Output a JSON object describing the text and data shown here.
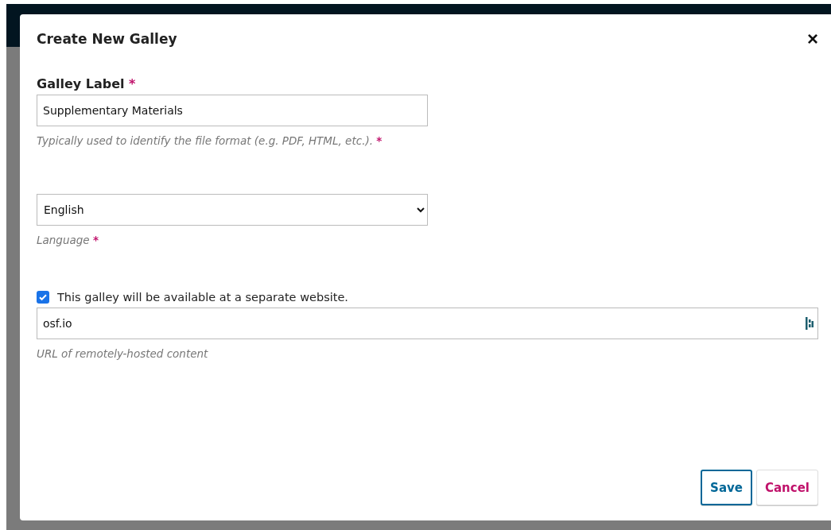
{
  "dialog": {
    "title": "Create New Galley",
    "close": "×"
  },
  "fields": [
    {
      "kind": "text",
      "label": "Galley Label",
      "label_mark": "*",
      "value": "Supplementary Materials",
      "hint": "Typically used to identify the file format (e.g. PDF, HTML, etc.).",
      "hint_mark": "*"
    },
    {
      "kind": "select",
      "value": "English",
      "hint": "Language",
      "hint_mark": "*"
    },
    {
      "kind": "checkbox",
      "label": "This galley will be available at a separate website.",
      "checked": true
    },
    {
      "kind": "url",
      "value": "osf.io",
      "hint": "URL of remotely-hosted content"
    }
  ],
  "buttons": [
    {
      "label": "Save",
      "kind": "primary",
      "focused": true
    },
    {
      "label": "Cancel",
      "kind": "cancel",
      "focused": false
    }
  ]
}
